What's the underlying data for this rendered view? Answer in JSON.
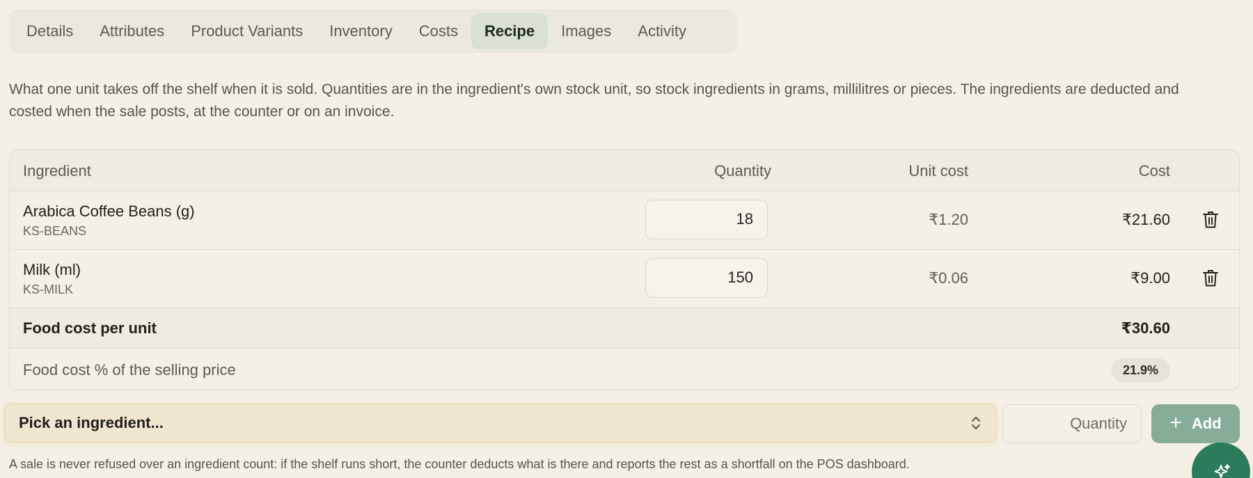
{
  "tabs": [
    {
      "label": "Details"
    },
    {
      "label": "Attributes"
    },
    {
      "label": "Product Variants"
    },
    {
      "label": "Inventory"
    },
    {
      "label": "Costs"
    },
    {
      "label": "Recipe",
      "active": true
    },
    {
      "label": "Images"
    },
    {
      "label": "Activity"
    }
  ],
  "intro": "What one unit takes off the shelf when it is sold. Quantities are in the ingredient's own stock unit, so stock ingredients in grams, millilitres or pieces. The ingredients are deducted and costed when the sale posts, at the counter or on an invoice.",
  "table": {
    "headers": {
      "ingredient": "Ingredient",
      "quantity": "Quantity",
      "unit_cost": "Unit cost",
      "cost": "Cost"
    },
    "rows": [
      {
        "name": "Arabica Coffee Beans (g)",
        "sku": "KS-BEANS",
        "quantity": "18",
        "unit_cost": "₹1.20",
        "cost": "₹21.60"
      },
      {
        "name": "Milk (ml)",
        "sku": "KS-MILK",
        "quantity": "150",
        "unit_cost": "₹0.06",
        "cost": "₹9.00"
      }
    ],
    "total": {
      "label": "Food cost per unit",
      "value": "₹30.60"
    },
    "percentage": {
      "label": "Food cost % of the selling price",
      "value": "21.9%"
    }
  },
  "add_form": {
    "picker_label": "Pick an ingredient...",
    "quantity_placeholder": "Quantity",
    "add_label": "Add"
  },
  "note": "A sale is never refused over an ingredient count: if the shelf runs short, the counter deducts what is there and reports the rest as a shortfall on the POS dashboard.",
  "icons": {
    "delete": "trash-icon",
    "picker": "chevron-up-down-icon",
    "add": "plus-icon",
    "assistant": "sparkle-icon"
  },
  "colors": {
    "accent": "#2c7c5c",
    "add_button": "#87ad99",
    "active_tab": "#d9e0d4"
  }
}
